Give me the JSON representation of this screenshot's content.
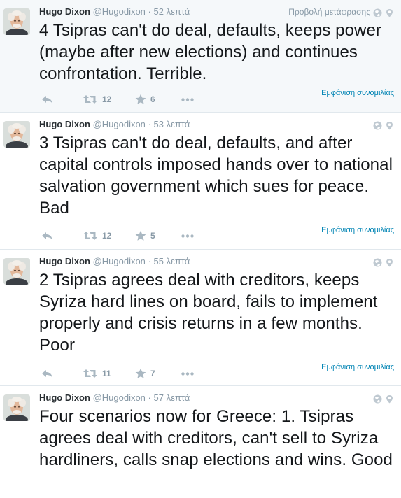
{
  "tweets": [
    {
      "fullname": "Hugo Dixon",
      "username": "@Hugodixon",
      "separator": "·",
      "time": "52 λεπτά",
      "translate": "Προβολή μετάφρασης",
      "text": "4 Tsipras can't do deal, defaults, keeps power (maybe after new elections) and continues confrontation. Terrible.",
      "retweets": "12",
      "favorites": "6",
      "conversation": "Εμφάνιση συνομιλίας"
    },
    {
      "fullname": "Hugo Dixon",
      "username": "@Hugodixon",
      "separator": "·",
      "time": "53 λεπτά",
      "text": "3 Tsipras can't do deal, defaults, and after capital controls imposed hands over to national salvation government which sues for peace. Bad",
      "retweets": "12",
      "favorites": "5",
      "conversation": "Εμφάνιση συνομιλίας"
    },
    {
      "fullname": "Hugo Dixon",
      "username": "@Hugodixon",
      "separator": "·",
      "time": "55 λεπτά",
      "text": "2 Tsipras agrees deal with creditors, keeps Syriza hard lines on board, fails to implement properly and crisis returns in a few months. Poor",
      "retweets": "11",
      "favorites": "7",
      "conversation": "Εμφάνιση συνομιλίας"
    },
    {
      "fullname": "Hugo Dixon",
      "username": "@Hugodixon",
      "separator": "·",
      "time": "57 λεπτά",
      "text": "Four scenarios now for Greece: 1. Tsipras agrees deal with creditors, can't sell to Syriza hardliners, calls snap elections and wins. Good"
    }
  ],
  "icons": {
    "reply": "reply-icon",
    "retweet": "retweet-icon",
    "favorite": "star-icon",
    "more": "more-icon",
    "globe": "globe-icon",
    "location": "location-pin-icon"
  },
  "colors": {
    "link": "#0084b4",
    "muted": "#8899a6",
    "highlight_bg": "#f5f8fa",
    "text": "#14171a"
  }
}
